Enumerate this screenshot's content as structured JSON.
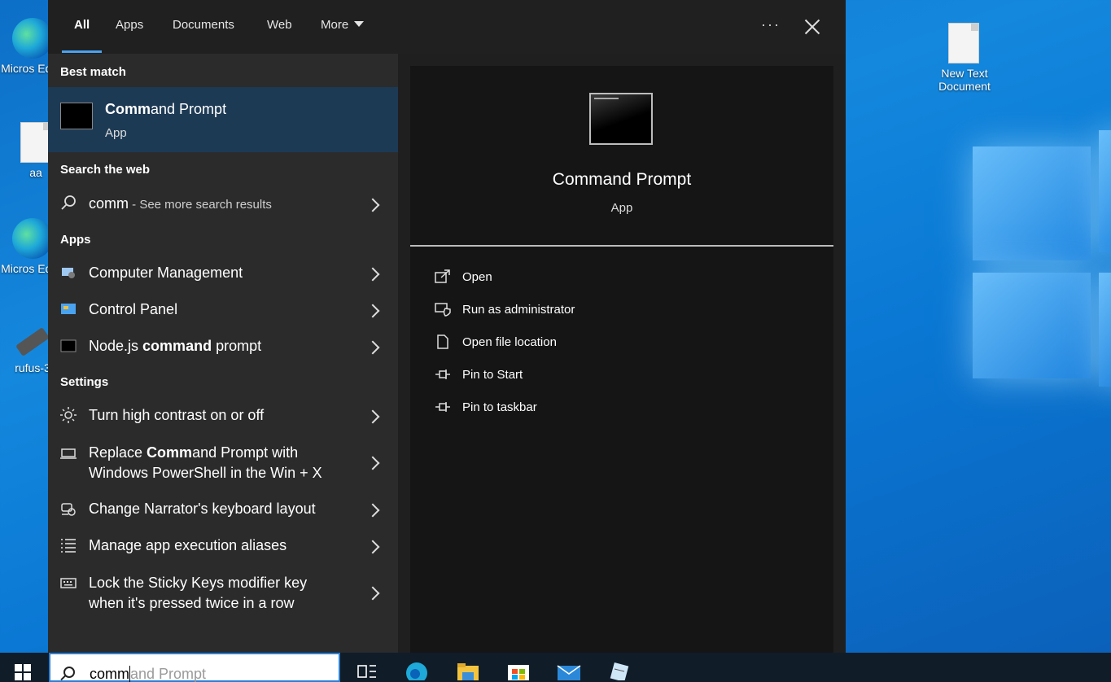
{
  "desktop": {
    "icons": [
      {
        "label": "Micros Edge"
      },
      {
        "label": "aa"
      },
      {
        "label": "Micros Edge"
      },
      {
        "label": "rufus-3"
      },
      {
        "label": "New Text Document"
      }
    ]
  },
  "tabs": [
    {
      "label": "All"
    },
    {
      "label": "Apps"
    },
    {
      "label": "Documents"
    },
    {
      "label": "Web"
    },
    {
      "label": "More"
    }
  ],
  "toolbar": {
    "more_options": "···"
  },
  "best_match": {
    "heading": "Best match",
    "title_bold": "Comm",
    "title_rest": "and Prompt",
    "subtitle": "App"
  },
  "search_web": {
    "heading": "Search the web",
    "query": "comm",
    "suffix": " - See more search results"
  },
  "apps": {
    "heading": "Apps",
    "items": [
      {
        "label": "Computer Management"
      },
      {
        "label": "Control Panel"
      },
      {
        "pre": "Node.js ",
        "bold": "command",
        "post": " prompt"
      }
    ]
  },
  "settings": {
    "heading": "Settings",
    "items": [
      {
        "label": "Turn high contrast on or off"
      },
      {
        "pre": "Replace ",
        "bold": "Comm",
        "post": "and Prompt with",
        "line2": "Windows PowerShell in the Win + X"
      },
      {
        "label": "Change Narrator's keyboard layout"
      },
      {
        "label": "Manage app execution aliases"
      },
      {
        "line1": "Lock the Sticky Keys modifier key",
        "line2": "when it's pressed twice in a row"
      }
    ]
  },
  "preview": {
    "title": "Command Prompt",
    "subtitle": "App",
    "actions": [
      {
        "label": "Open"
      },
      {
        "label": "Run as administrator"
      },
      {
        "label": "Open file location"
      },
      {
        "label": "Pin to Start"
      },
      {
        "label": "Pin to taskbar"
      }
    ]
  },
  "search": {
    "typed": "comm",
    "completion": "and Prompt"
  }
}
